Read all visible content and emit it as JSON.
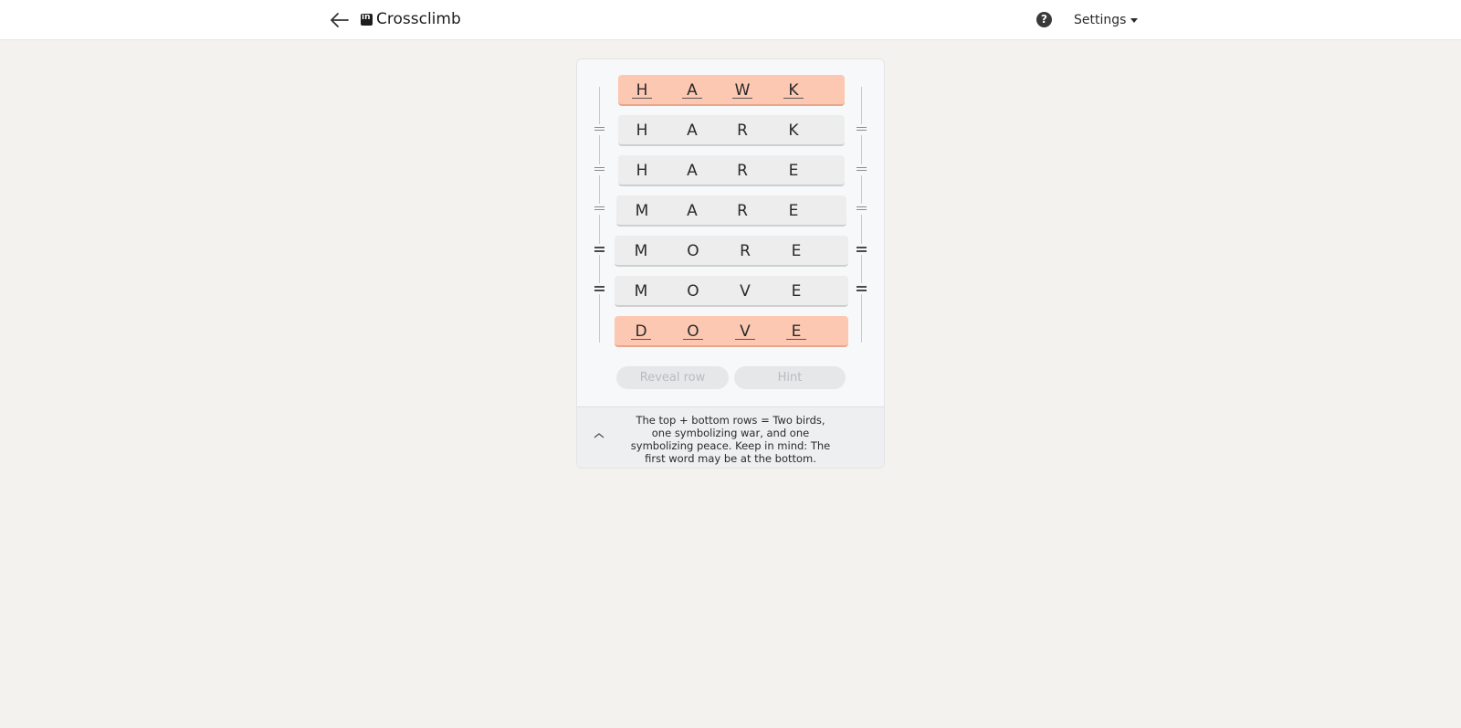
{
  "header": {
    "title": "Crosscli​mb",
    "logo_text": "in",
    "help_label": "?",
    "settings_label": "Settings"
  },
  "puzzle": {
    "rows": [
      {
        "letters": [
          "H",
          "A",
          "W",
          "K"
        ],
        "state": "endpoint"
      },
      {
        "letters": [
          "H",
          "A",
          "R",
          "K"
        ],
        "state": "middle"
      },
      {
        "letters": [
          "H",
          "A",
          "R",
          "E"
        ],
        "state": "middle"
      },
      {
        "letters": [
          "M",
          "A",
          "R",
          "E"
        ],
        "state": "middle"
      },
      {
        "letters": [
          "M",
          "O",
          "R",
          "E"
        ],
        "state": "middle"
      },
      {
        "letters": [
          "M",
          "O",
          "V",
          "E"
        ],
        "state": "middle"
      },
      {
        "letters": [
          "D",
          "O",
          "V",
          "E"
        ],
        "state": "endpoint"
      }
    ]
  },
  "controls": {
    "reveal_row_label": "Reveal row",
    "hint_label": "Hint"
  },
  "clue": {
    "text": "The top + bottom rows = Two birds, one symbolizing war, and one symbolizing peace. Keep in mind: The first word may be at the bottom."
  },
  "colors": {
    "endpoint_row": "#fdc8b2",
    "middle_row": "#ededed",
    "page_background": "#f3f2ef"
  }
}
